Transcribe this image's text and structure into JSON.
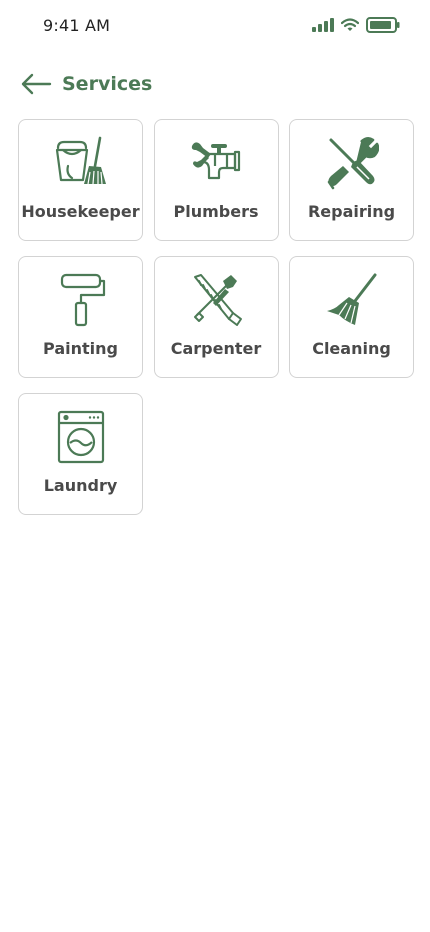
{
  "status_bar": {
    "time": "9:41 AM"
  },
  "header": {
    "title": "Services"
  },
  "theme": {
    "accent": "#4c7a56",
    "card_border": "#d3d3d3",
    "label_color": "#4a4a4a"
  },
  "services": [
    {
      "label": "Housekeeper",
      "icon": "bucket-broom-icon"
    },
    {
      "label": "Plumbers",
      "icon": "faucet-wrench-icon"
    },
    {
      "label": "Repairing",
      "icon": "wrench-screwdriver-icon"
    },
    {
      "label": "Painting",
      "icon": "paint-roller-icon"
    },
    {
      "label": "Carpenter",
      "icon": "hammer-saw-icon"
    },
    {
      "label": "Cleaning",
      "icon": "broom-icon"
    },
    {
      "label": "Laundry",
      "icon": "washing-machine-icon"
    }
  ]
}
